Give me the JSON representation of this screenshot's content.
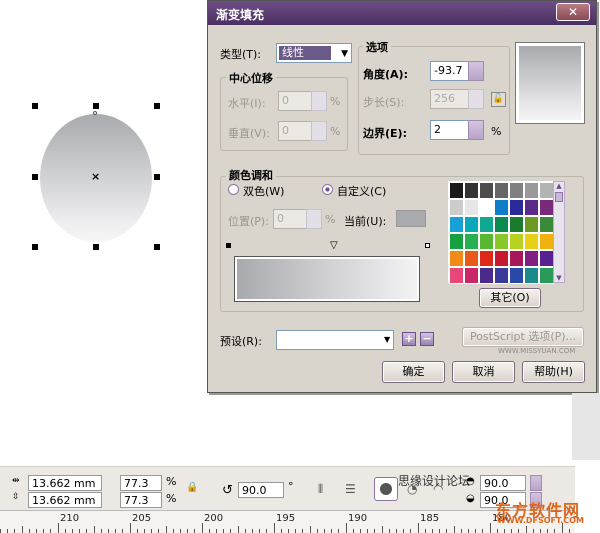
{
  "dialog": {
    "title": "渐变填充",
    "close_label": "✕",
    "type_label": "类型(T):",
    "type_value": "线性",
    "options_label": "选项",
    "center_offset_label": "中心位移",
    "horizontal_label": "水平(I):",
    "horizontal_value": "0",
    "vertical_label": "垂直(V):",
    "vertical_value": "0",
    "angle_label": "角度(A):",
    "angle_value": "-93.7",
    "steps_label": "步长(S):",
    "steps_value": "256",
    "edge_label": "边界(E):",
    "edge_value": "2",
    "percent": "%",
    "color_blend_label": "颜色调和",
    "two_color_label": "双色(W)",
    "custom_label": "自定义(C)",
    "position_label": "位置(P):",
    "position_value": "0",
    "current_label": "当前(U):",
    "other_button": "其它(O)",
    "preset_label": "预设(R):",
    "preset_value": "",
    "postscript_button": "PostScript 选项(P)...",
    "ok_button": "确定",
    "cancel_button": "取消",
    "help_button": "帮助(H)",
    "watermark_text": "WWW.MISSYUAN.COM",
    "colors": {
      "palette": [
        [
          "#1a1a1a",
          "#333333",
          "#4d4d4d",
          "#666666",
          "#808080",
          "#999999",
          "#b3b3b3"
        ],
        [
          "#cccccc",
          "#e6e6e6",
          "#ffffff",
          "#0e7ec8",
          "#2a2a9a",
          "#5a2a8a",
          "#7a2a7a"
        ],
        [
          "#1aa0d8",
          "#0aa8b8",
          "#10a890",
          "#0a8a50",
          "#1a7a30",
          "#6a9a20",
          "#3a8a3a"
        ],
        [
          "#18a040",
          "#28b050",
          "#58b830",
          "#88c828",
          "#b8d020",
          "#e8d018",
          "#f0b010"
        ],
        [
          "#f08a18",
          "#e85a18",
          "#e02818",
          "#c81830",
          "#a81858",
          "#802080",
          "#5a2090"
        ],
        [
          "#e84878",
          "#c82868",
          "#4a2a8a",
          "#3a3a9a",
          "#2a4aaa",
          "#1a8a8a",
          "#2a9a5a"
        ]
      ]
    }
  },
  "toolbar": {
    "width_value": "13.662 mm",
    "height_value": "13.662 mm",
    "scale_x": "77.3",
    "scale_y": "77.3",
    "percent": "%",
    "rotation_value": "90.0",
    "degree": "°",
    "forum_text": "思缘设计论坛",
    "skew_top": "90.0",
    "skew_bottom": "90.0"
  },
  "ruler": {
    "labels": [
      "210",
      "205",
      "200",
      "195",
      "190",
      "185",
      "180"
    ]
  },
  "site_watermark": {
    "title": "东方软件网",
    "url": "WWW.DFSOFT.COM"
  }
}
